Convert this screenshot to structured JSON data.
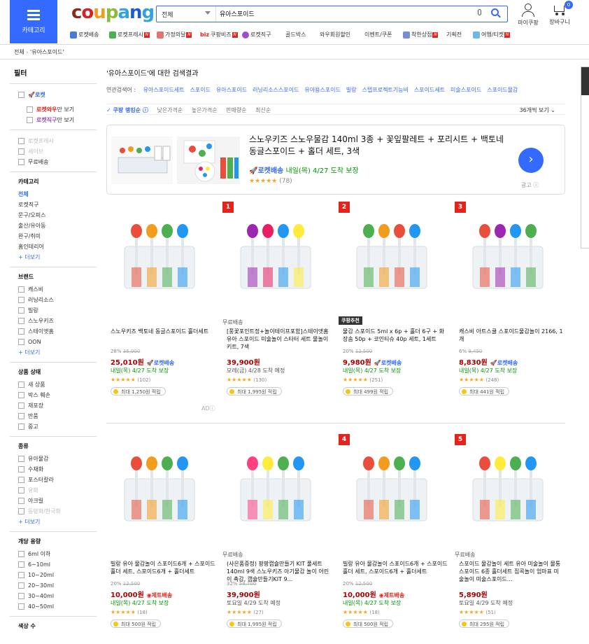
{
  "header": {
    "category_label": "카테고리",
    "logo": [
      "c",
      "o",
      "u",
      "p",
      "a",
      "n",
      "g"
    ],
    "search_select": "전체",
    "search_value": "유아스포이드",
    "my_coupang": "마이쿠팡",
    "cart": "장바구니",
    "cart_count": "0"
  },
  "nav": [
    "로켓배송",
    "로켓프레시",
    "가정의달",
    "쿠팡비즈",
    "로켓직구",
    "골드박스",
    "와우회원할인",
    "이벤트/쿠폰",
    "착한상점",
    "기획전",
    "여행/티켓"
  ],
  "breadcrumb": {
    "home": "전체",
    "current": "'유아스포이드'"
  },
  "sidebar": {
    "filter_title": "필터",
    "rocket": "로켓",
    "wow_only": "로켓와우",
    "wow_suffix": "만 보기",
    "direct_only": "로켓직구",
    "direct_suffix": "만 보기",
    "disabled1": "로켓프레시",
    "disabled2": "세이브",
    "free_ship": "무료배송",
    "cat_title": "카테고리",
    "cats": [
      "전체",
      "로켓직구",
      "문구/오피스",
      "출산/유아동",
      "완구/취미",
      "홈인테리어"
    ],
    "more": "+ 더보기",
    "brand_title": "브랜드",
    "brands": [
      "캐스비",
      "러닝리소스",
      "빌랑",
      "스노우키즈",
      "스테이앳홈",
      "OON"
    ],
    "state_title": "상품 상태",
    "states": [
      "새 상품",
      "박스 훼손",
      "재포장",
      "반품",
      "중고"
    ],
    "kind_title": "종류",
    "kinds": [
      "유아물감",
      "수채화",
      "포스터칼라",
      "유화",
      "아크릴",
      "동양화/한국화"
    ],
    "vol_title": "개당 용량",
    "vols": [
      "6ml 이하",
      "6~10ml",
      "10~20ml",
      "20~30ml",
      "30~40ml",
      "40~50ml"
    ],
    "color_title": "색상 수"
  },
  "main": {
    "query_title": "'유아스포이드'에 대한 검색결과",
    "related_label": "연관검색어 :",
    "related": [
      "유아스포이드세트",
      "스포이드",
      "유아스포이드",
      "러닝리소스스포이드",
      "유아용스포이드",
      "빌랑",
      "스텝프로젝트기능비",
      "스포이드세트",
      "미술스포이드",
      "스포이드물감"
    ],
    "sort": [
      "쿠팡 랭킹순",
      "낮은가격순",
      "높은가격순",
      "판매량순",
      "최신순"
    ],
    "per_page": "36개씩 보기"
  },
  "ad": {
    "title": "스노우키즈 스노우물감 140ml 3종 + 꽃잎팔레트 + 포리시트 + 백토네 동글스포이드 + 홀더 세트, 3색",
    "rocket": "로켓배송",
    "ship": "내일(목) 4/27 도착 보장",
    "stars": "★★★★★",
    "reviews": "(78)",
    "ad_label": "광고"
  },
  "products": [
    {
      "rank": "",
      "top_label": "",
      "name": "스노우키즈 백토네 동글스포이드 홀더세트",
      "discount": "28%",
      "orig": "35,000",
      "price": "25,010원",
      "tag": "로켓배송",
      "tagtype": "rocket",
      "ship": "내일(목) 4/27 도착 보장",
      "shipgray": false,
      "stars": "★★★★★",
      "reviews": "(102)",
      "points": "최대 1,250원 적립"
    },
    {
      "rank": "1",
      "top_label": "무료배송",
      "name": "[풍꽃포인트정+놀이테이프포함]스테이앳홈 유아 스포이드 미술놀이 스타터 세트 물놀이키트, 7색",
      "discount": "",
      "orig": "",
      "price": "39,900원",
      "tag": "",
      "tagtype": "",
      "ship": "모레(금) 4/28 도착 예정",
      "shipgray": true,
      "stars": "★★★★★",
      "reviews": "(130)",
      "points": "최대 1,995원 적립"
    },
    {
      "rank": "2",
      "top_label": "쿠팡추천",
      "name": "물감 스포이드 5ml x 6p + 홀더 6구 + 화장솜 50p + 코인티슈 40p 세트, 1세트",
      "discount": "20%",
      "orig": "12,500",
      "price": "9,980원",
      "tag": "로켓배송",
      "tagtype": "rocket",
      "ship": "내일(목) 4/27 도착 보장",
      "shipgray": false,
      "stars": "★★★★★",
      "reviews": "(251)",
      "points": "최대 499원 적립"
    },
    {
      "rank": "3",
      "top_label": "",
      "name": "캐스비 아트스쿨 스포이드물감놀이 2166, 1개",
      "discount": "6%",
      "orig": "9,450",
      "price": "8,830원",
      "tag": "로켓배송",
      "tagtype": "rocket",
      "ship": "내일(목) 4/27 도착 보장",
      "shipgray": false,
      "stars": "★★★★★",
      "reviews": "(248)",
      "points": "최대 441원 적립"
    },
    {
      "rank": "",
      "top_label": "",
      "name": "빌랑 유아 물감놀이 스포이드6개 + 스포이드홀더 세트, 스포이드6개 + 홀더세트",
      "discount": "20%",
      "orig": "12,500",
      "price": "10,000원",
      "tag": "제트배송",
      "tagtype": "jet",
      "ship": "내일(목) 4/27 도착 보장",
      "shipgray": false,
      "stars": "★★★★★",
      "reviews": "(18)",
      "points": "최대 500원 적립"
    },
    {
      "rank": "",
      "top_label": "무료배송",
      "name": "(사은품증정) 팡팡캡슐만들기 KIT 풀세트 140ml 9색 스노우키즈 아기물감 놀이 어린이 촉감, 캡슐만들기KIT 9...",
      "discount": "32%",
      "orig": "58,700",
      "price": "39,900원",
      "tag": "",
      "tagtype": "",
      "ship": "토요일 4/29 도착 예정",
      "shipgray": true,
      "stars": "★★★★★",
      "reviews": "(27)",
      "points": "최대 1,995원 적립"
    },
    {
      "rank": "4",
      "top_label": "",
      "name": "빌랑 유아 물감놀이 스포이드6개 + 스포이드홀더 세트, 스포이드6개 + 홀더세트",
      "discount": "20%",
      "orig": "12,500",
      "price": "10,000원",
      "tag": "제트배송",
      "tagtype": "jet",
      "ship": "내일(목) 4/27 도착 보장",
      "shipgray": false,
      "stars": "★★★★★",
      "reviews": "(18)",
      "points": "최대 500원 적립"
    },
    {
      "rank": "5",
      "top_label": "무료배송",
      "name": "스포이드 물감놀이 세트 유아 미술놀이 물통 스포이드 6종 홀더세트 집콕놀이 엄마표 미술놀이 미술스포이드...",
      "discount": "",
      "orig": "",
      "price": "5,890원",
      "tag": "",
      "tagtype": "",
      "ship": "토요일 4/29 도착 예정",
      "shipgray": true,
      "stars": "★★★★★",
      "reviews": "(51)",
      "points": "최대 295원 적립"
    }
  ],
  "ad_small": "AD",
  "colors": {
    "blue": "#346aff",
    "red": "#ae0000",
    "green": "#009a00"
  }
}
